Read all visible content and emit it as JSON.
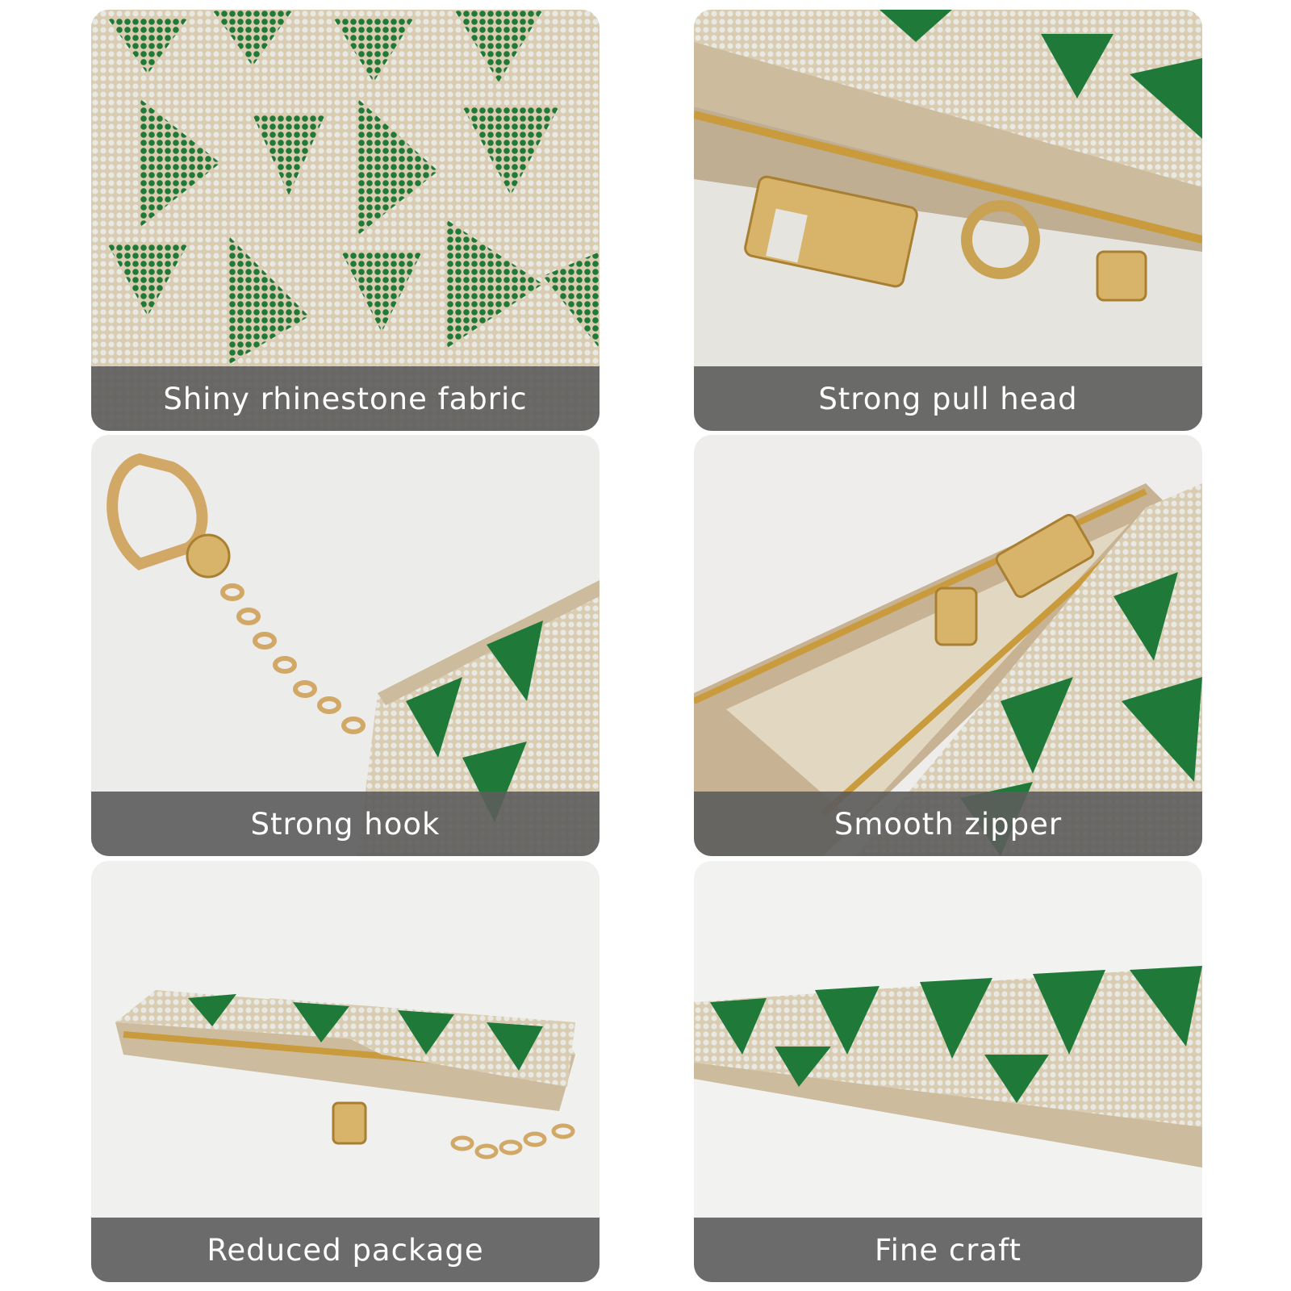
{
  "panels": [
    {
      "caption": "Shiny rhinestone fabric",
      "subject": "rhinestone-fabric-closeup"
    },
    {
      "caption": "Strong pull head",
      "subject": "zipper-pull-head-closeup"
    },
    {
      "caption": "Strong hook",
      "subject": "keychain-hook-and-chain"
    },
    {
      "caption": "Smooth zipper",
      "subject": "open-zipper-closeup"
    },
    {
      "caption": "Reduced package",
      "subject": "coin-purse-side-view"
    },
    {
      "caption": "Fine craft",
      "subject": "purse-edge-detail"
    }
  ],
  "colors": {
    "rhinestone_green": "#1f7a3a",
    "rhinestone_silver": "#d8d8d2",
    "fabric_beige": "#d9c8aa",
    "gold_hardware": "#d8b36a",
    "caption_bar": "#5c5c5c",
    "background": "#f2f2f0"
  }
}
